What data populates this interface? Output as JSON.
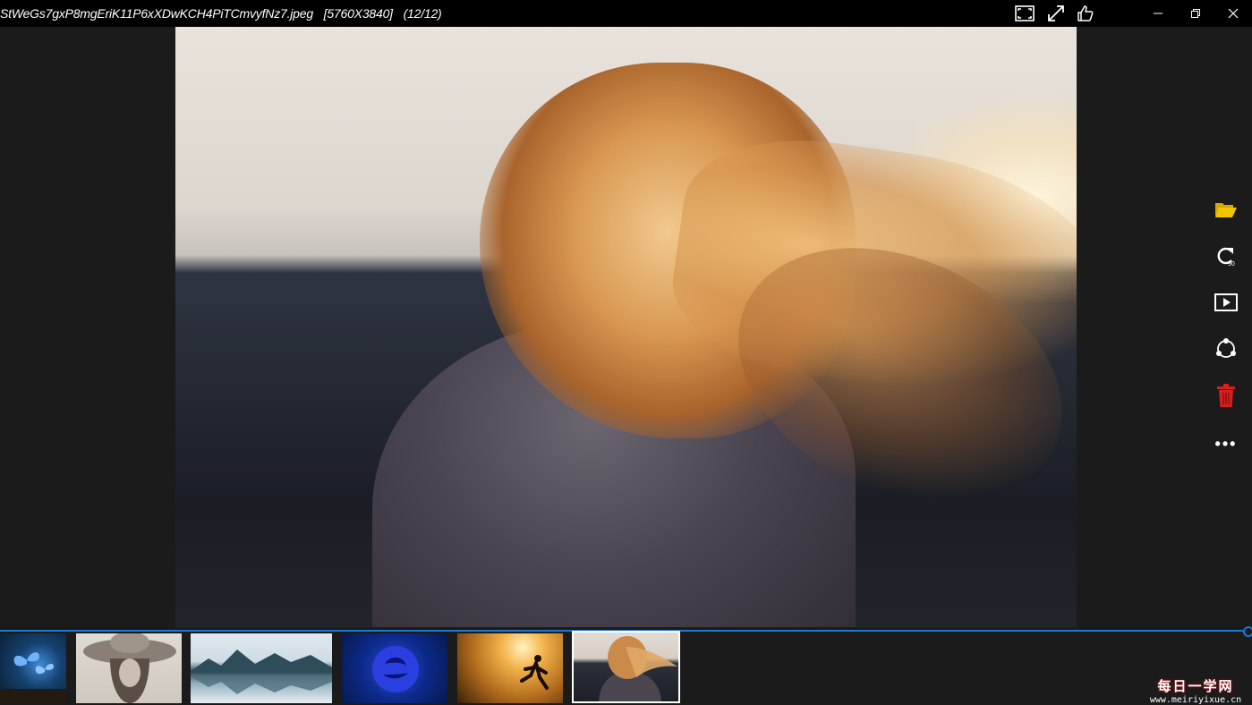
{
  "titlebar": {
    "filename": "StWeGs7gxP8mgEriK11P6xXDwKCH4PiTCmvyfNz7.jpeg",
    "dimensions": "[5760X3840]",
    "position": "(12/12)",
    "icons": [
      "fit-screen-icon",
      "fullscreen-icon",
      "thumbs-up-icon"
    ],
    "window_buttons": {
      "minimize": "–",
      "restore": "❐",
      "close": "✕"
    }
  },
  "viewer": {
    "image_name": "woman with windblown blonde hair at sunset"
  },
  "right_toolbar": {
    "items": [
      {
        "name": "open-folder",
        "color": "#f5c400"
      },
      {
        "name": "rotate-90",
        "label": "90"
      },
      {
        "name": "slideshow"
      },
      {
        "name": "share"
      },
      {
        "name": "delete",
        "color": "#d81f1f"
      },
      {
        "name": "more",
        "label": "•••"
      }
    ]
  },
  "progress": {
    "value": 1.0
  },
  "thumbnails": {
    "selected_index": 5,
    "items": [
      {
        "subject": "blue butterflies",
        "colors": [
          "#0e2a4a",
          "#2e6fb8"
        ]
      },
      {
        "subject": "woman in sun hat (sepia)",
        "colors": [
          "#d8d3cc",
          "#6b5f56"
        ]
      },
      {
        "subject": "mountain lake reflection",
        "colors": [
          "#e8eef2",
          "#3a5a6c"
        ]
      },
      {
        "subject": "blue rose",
        "colors": [
          "#0a2a8a",
          "#2e4fd6"
        ]
      },
      {
        "subject": "runner at sunset",
        "colors": [
          "#f3b34a",
          "#4a2a10"
        ]
      },
      {
        "subject": "windblown hair",
        "colors": [
          "#d9cfc4",
          "#3e3a44"
        ]
      }
    ]
  },
  "watermark": {
    "line1": "每日一学网",
    "line2": "www.meiriyixue.cn"
  }
}
